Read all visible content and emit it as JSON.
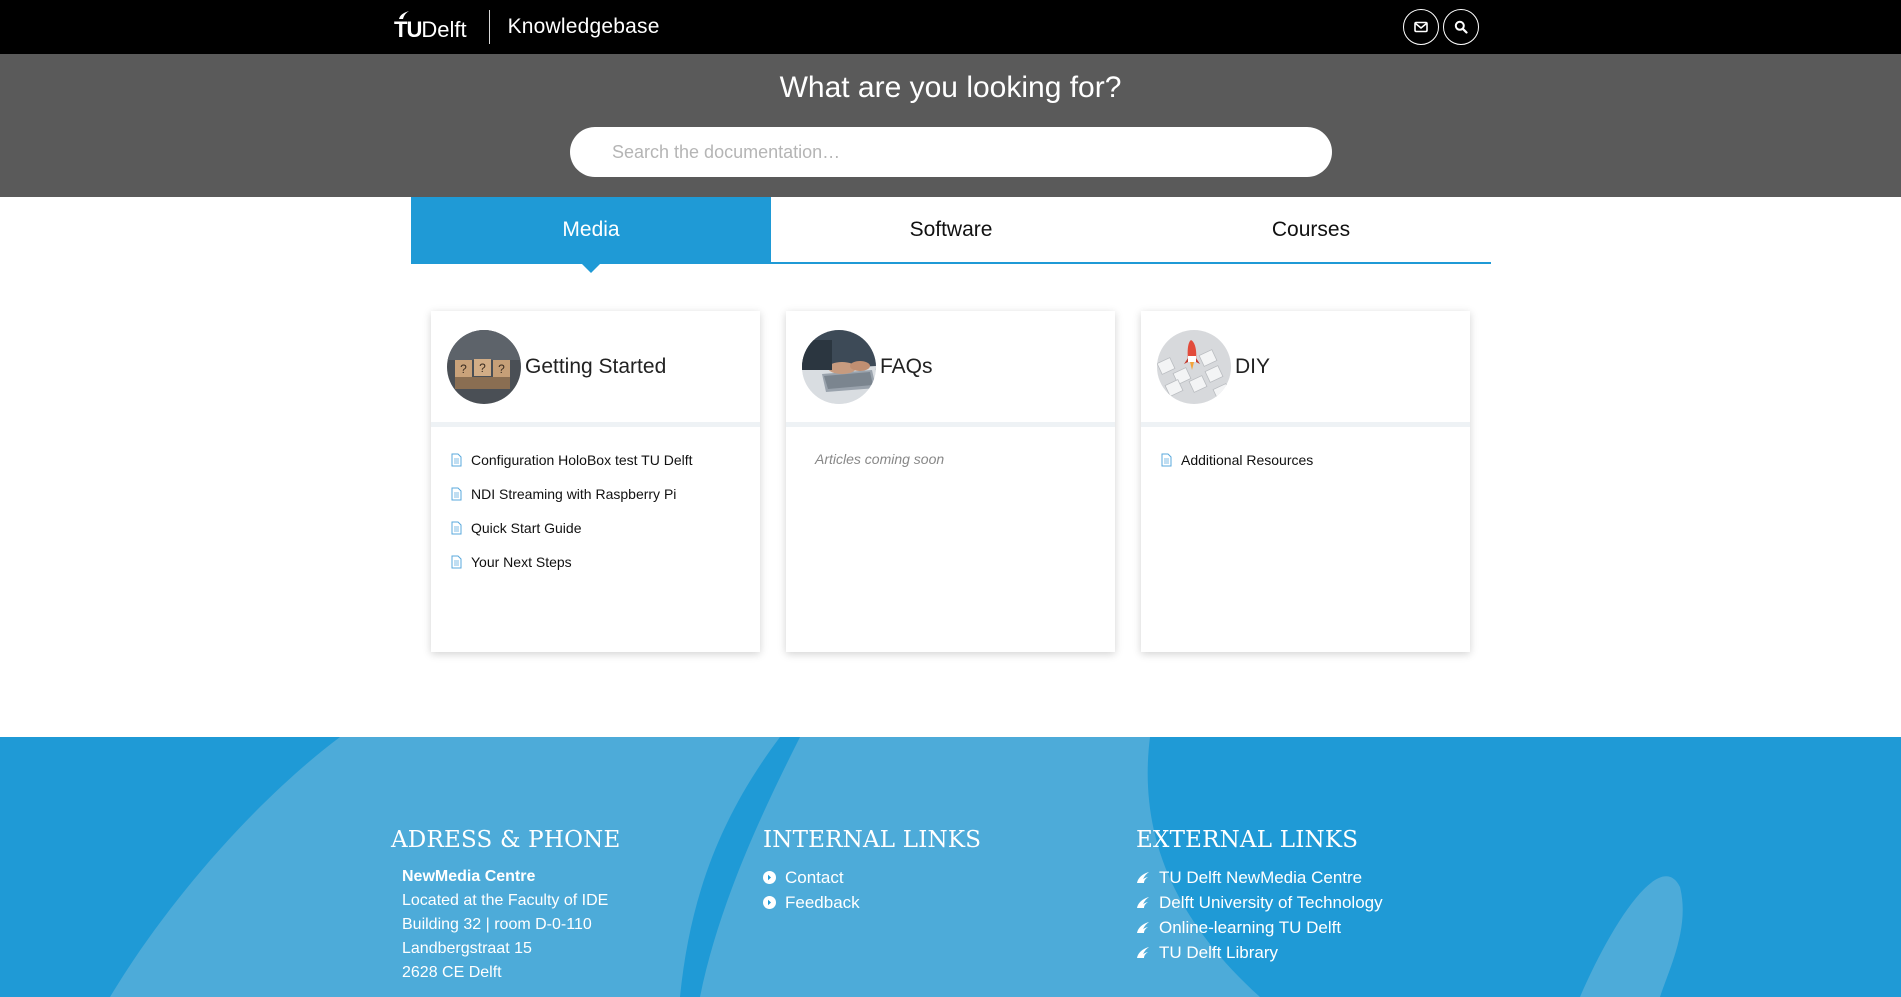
{
  "header": {
    "logo_tu": "TU",
    "logo_delft": "Delft",
    "site_title": "Knowledgebase",
    "icons": [
      "mail-icon",
      "search-icon"
    ]
  },
  "hero": {
    "title": "What are you looking for?",
    "search_placeholder": "Search the documentation…",
    "search_value": ""
  },
  "tabs": [
    {
      "label": "Media",
      "active": true
    },
    {
      "label": "Software",
      "active": false
    },
    {
      "label": "Courses",
      "active": false
    }
  ],
  "cards": [
    {
      "title": "Getting Started",
      "articles": [
        "Configuration HoloBox test TU Delft",
        "NDI Streaming with Raspberry Pi",
        "Quick Start Guide",
        "Your Next Steps"
      ]
    },
    {
      "title": "FAQs",
      "empty_text": "Articles coming soon"
    },
    {
      "title": "DIY",
      "articles": [
        "Additional Resources"
      ]
    }
  ],
  "footer": {
    "address": {
      "heading": "ADRESS & PHONE",
      "name": "NewMedia Centre",
      "lines": [
        "Located at the Faculty of IDE",
        "Building 32 | room D-0-110",
        "Landbergstraat 15",
        "2628 CE  Delft"
      ]
    },
    "internal": {
      "heading": "INTERNAL LINKS",
      "links": [
        "Contact",
        "Feedback"
      ]
    },
    "external": {
      "heading": "EXTERNAL LINKS",
      "links": [
        "TU Delft NewMedia Centre",
        "Delft University of Technology",
        "Online-learning TU Delft",
        "TU Delft Library"
      ]
    }
  },
  "colors": {
    "accent": "#1f9ad6",
    "header_bg": "#000000",
    "hero_bg": "#5a5a5a"
  }
}
